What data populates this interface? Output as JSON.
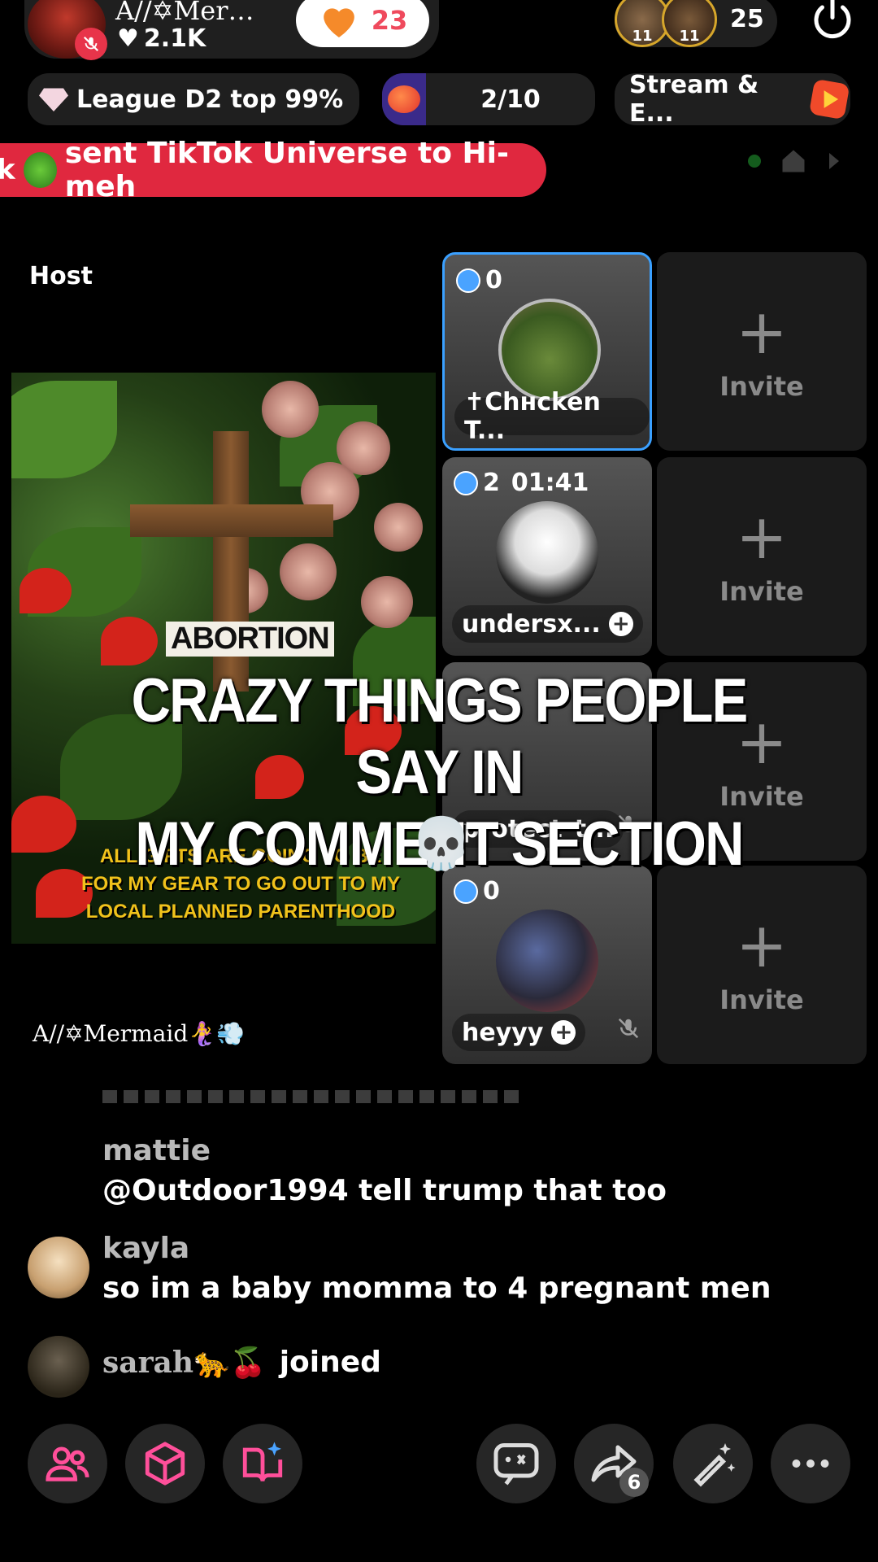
{
  "top": {
    "host_name": "A//✡Mer…",
    "likes": "2.1K",
    "like_count": "23",
    "viewer_avatar_levels": [
      "11",
      "11"
    ],
    "viewer_count": "25"
  },
  "status": {
    "league": "League D2 top 99%",
    "progress": "2/10",
    "stream_label": "Stream & E..."
  },
  "banner": {
    "text": "sent TikTok Universe to Hi-meh"
  },
  "host": {
    "label": "Host",
    "handle": "A//✡Mermaid🧜‍♀️💨",
    "video_text_1": "ABORTION",
    "video_text_2": "ALL GIFTS ARE GOING TO BE FOR MY GEAR TO GO OUT TO MY LOCAL PLANNED PARENTHOOD"
  },
  "guests": [
    {
      "badge": "0",
      "name": "✝Chʜcken T...",
      "timer": ""
    },
    {
      "badge": "2",
      "name": "undersx...",
      "timer": "01:41"
    },
    {
      "badge": "",
      "name": "protect_t...",
      "timer": ""
    },
    {
      "badge": "0",
      "name": "heyyy",
      "timer": ""
    }
  ],
  "invite_label": "Invite",
  "caption": {
    "line1": "CRAZY THINGS PEOPLE SAY IN",
    "line2": "MY COMMENT SECTION",
    "emoji": "💀"
  },
  "comments": [
    {
      "user": "mattie",
      "text": "@Outdoor1994 tell trump that too"
    },
    {
      "user": "kayla",
      "text": "so im a baby momma to 4 pregnant men"
    },
    {
      "user": "sarah🐆🍒",
      "text": "joined"
    }
  ],
  "toolbar": {
    "share_count": "6"
  },
  "colors": {
    "accent_red": "#e0283f",
    "like_text": "#ef4a5d",
    "invite_gray": "#8a8a8a",
    "badge_blue": "#4aa3ff"
  }
}
